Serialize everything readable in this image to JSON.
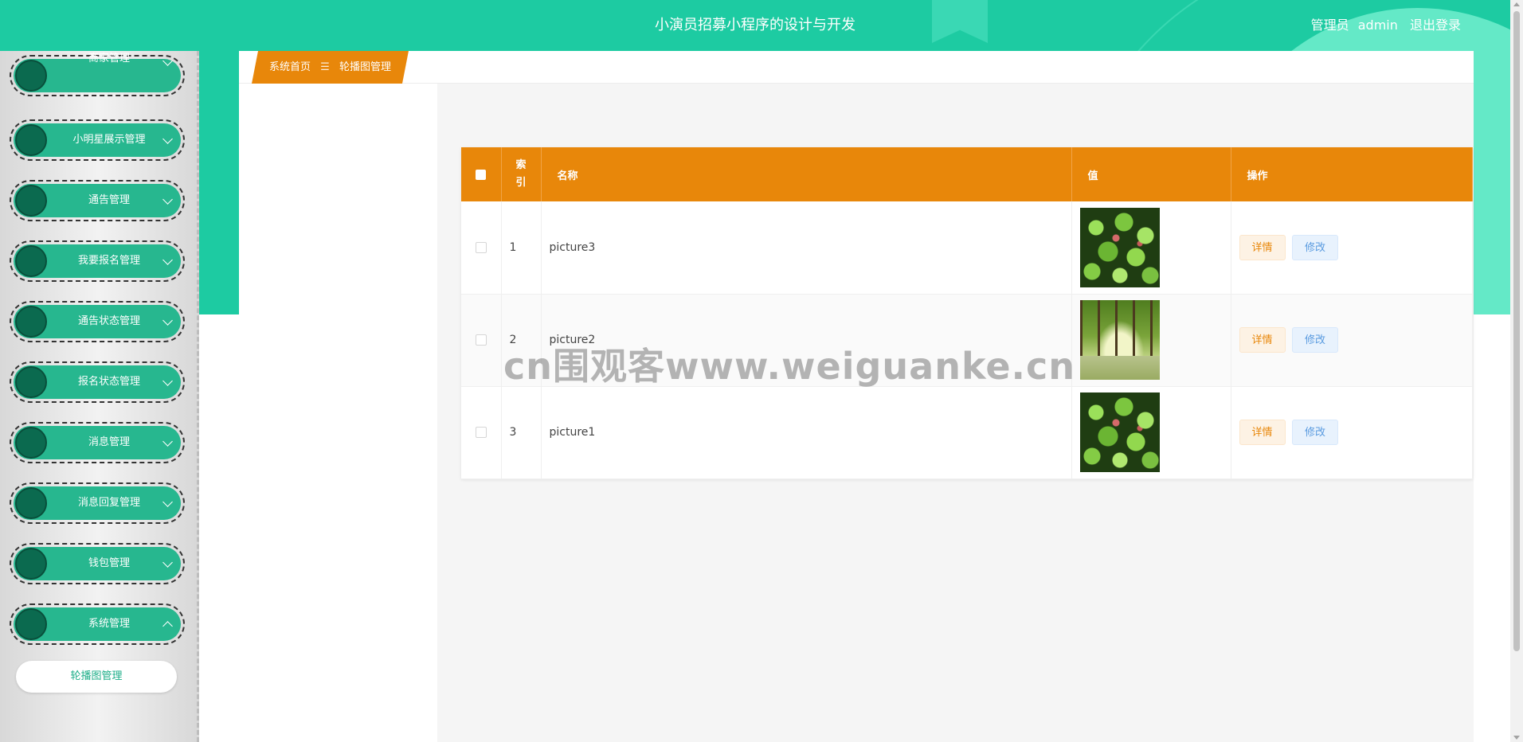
{
  "header": {
    "app_title": "小演员招募小程序的设计与开发",
    "user_role": "管理员",
    "username": "admin",
    "logout_label": "退出登录"
  },
  "colors": {
    "primary_green": "#1dcba2",
    "accent_orange": "#e8870a",
    "menu_pill": "#27b78f"
  },
  "sidebar": {
    "items": [
      {
        "label": "商家管理",
        "icon": "chevron-down-icon"
      },
      {
        "label": "小明星展示管理",
        "icon": "chevron-down-icon"
      },
      {
        "label": "通告管理",
        "icon": "chevron-down-icon"
      },
      {
        "label": "我要报名管理",
        "icon": "chevron-down-icon"
      },
      {
        "label": "通告状态管理",
        "icon": "chevron-down-icon"
      },
      {
        "label": "报名状态管理",
        "icon": "chevron-down-icon"
      },
      {
        "label": "消息管理",
        "icon": "chevron-down-icon"
      },
      {
        "label": "消息回复管理",
        "icon": "chevron-down-icon"
      },
      {
        "label": "钱包管理",
        "icon": "chevron-down-icon"
      },
      {
        "label": "系统管理",
        "icon": "chevron-up-icon"
      }
    ],
    "submenu": {
      "label": "轮播图管理"
    }
  },
  "breadcrumb": {
    "home": "系统首页",
    "separator": "☰",
    "current": "轮播图管理"
  },
  "table": {
    "headers": {
      "index": "索引",
      "name": "名称",
      "value": "值",
      "actions": "操作"
    },
    "rows": [
      {
        "index": "1",
        "name": "picture3",
        "image": "green-leaves-thumbnail",
        "detail_label": "详情",
        "edit_label": "修改"
      },
      {
        "index": "2",
        "name": "picture2",
        "image": "forest-path-thumbnail",
        "detail_label": "详情",
        "edit_label": "修改"
      },
      {
        "index": "3",
        "name": "picture1",
        "image": "green-leaves-thumbnail",
        "detail_label": "详情",
        "edit_label": "修改"
      }
    ]
  },
  "watermark": "cn围观客www.weiguanke.cn"
}
